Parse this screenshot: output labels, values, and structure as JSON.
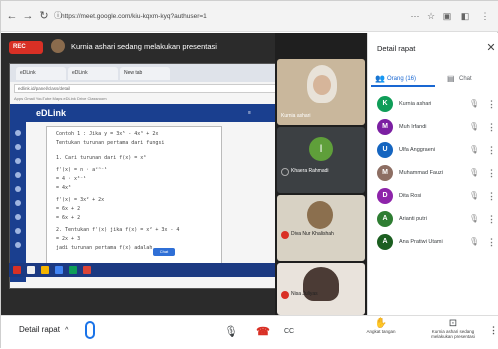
{
  "browser": {
    "url": "https://meet.google.com/kiu-kqxm-kyq?authuser=1",
    "back": "←",
    "forward": "→",
    "reload": "↻",
    "info": "ⓘ",
    "extensions": [
      "⋯",
      "☆",
      "▣",
      "◧",
      "⋮"
    ]
  },
  "meeting": {
    "rec_label": "REC",
    "presenting_message": "Kurnia ashari sedang melakukan presentasi"
  },
  "shared_screen": {
    "tabs": [
      "eDLink",
      "eDLink",
      "New tab"
    ],
    "url": "edlink.id/panel/class/detail",
    "bookmarks": "Apps  Gmail  YouTube  Maps  eDLink  Drive  Classroom",
    "logo": "eDLink",
    "header_right": "≡",
    "lines": [
      "Contoh 1 : Jika y = 3x⁵ - 4x³ + 2x",
      "Tentukan turunan pertama dari fungsi",
      "1.  Cari turunan dari f(x) = x⁴",
      "    f'(x) = n · aˣⁿ⁻¹",
      "         = 4 · x⁴⁻¹",
      "         = 4x³",
      "    f'(x) = 3x² + 2x",
      "         = 6x + 2",
      "    = 6x + 2",
      "2.  Tentukan f'(x) jika f(x) = x² + 3x - 4",
      "         = 2x + 3",
      "    jadi turunan pertama f(x) adalah..."
    ],
    "chat_button": "Chat"
  },
  "tiles": [
    {
      "name": "Kurnia ashari",
      "initial": ""
    },
    {
      "name": "Khaera Rahmadi",
      "initial": "I"
    },
    {
      "name": "Diva Nur Khalishah",
      "initial": ""
    },
    {
      "name": "Nisa Juliyas",
      "initial": ""
    }
  ],
  "panel": {
    "title": "Detail rapat",
    "close": "✕",
    "tab_people": "Orang (16)",
    "tab_chat": "Chat",
    "people": [
      {
        "initial": "K",
        "color": "#0f9d58",
        "name": "Kurnia ashari"
      },
      {
        "initial": "M",
        "color": "#7b1fa2",
        "name": "Muh Irfandi"
      },
      {
        "initial": "U",
        "color": "#1565c0",
        "name": "Ulfa Anggraeni"
      },
      {
        "initial": "M",
        "color": "#8d6e63",
        "name": "Muhammad Fauzi"
      },
      {
        "initial": "D",
        "color": "#8e24aa",
        "name": "Dita Rosi"
      },
      {
        "initial": "A",
        "color": "#2e7d32",
        "name": "Arianti putri"
      },
      {
        "initial": "A",
        "color": "#1b5e20",
        "name": "Ana Pratiwi Utami"
      }
    ]
  },
  "bottom": {
    "meeting_details": "Detail rapat",
    "chevron": "^",
    "raise_hand": "Angkat tangan",
    "presenting_label": "Kurnia ashari sedang melakukan presentasi",
    "mic_icon": "🎙",
    "hangup_icon": "☎",
    "captions_icon": "CC"
  },
  "colors": {
    "accent": "#1967d2",
    "rec": "#d93025",
    "meet_bg": "#2b2b2b",
    "edlink_blue": "#1a3f8f"
  }
}
